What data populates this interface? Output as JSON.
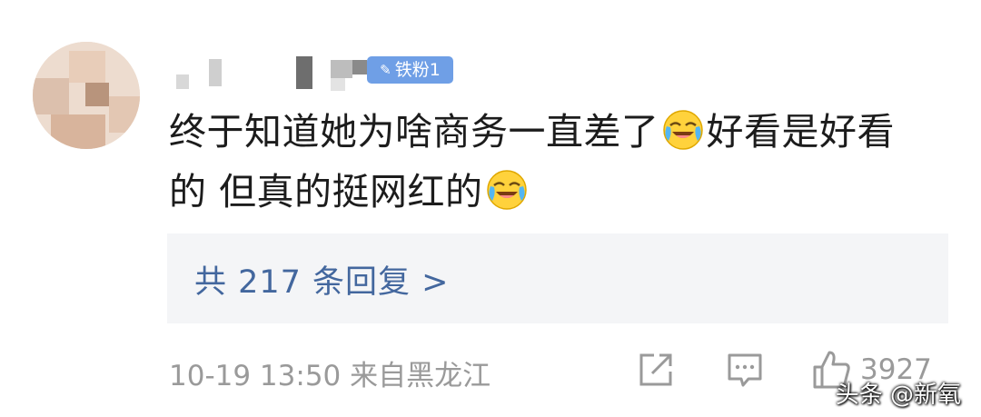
{
  "comment": {
    "badge": {
      "icon": "pen-icon",
      "label": "铁粉1",
      "color": "#6f9fe6"
    },
    "line1_a": "终于知道她为啥商务一直差了",
    "line1_b": "好看是好看",
    "line2_a": "的 但真的挺网红的",
    "emoji_name": "laugh-cry-emoji"
  },
  "replies": {
    "label": "共 217 条回复 >"
  },
  "footer": {
    "meta": "10-19 13:50 来自黑龙江",
    "like_count": "3927"
  },
  "watermark": "头条 @新氧",
  "colors": {
    "link": "#43679e",
    "meta": "#9a9a9a",
    "reply_bg": "#f4f5f7"
  }
}
